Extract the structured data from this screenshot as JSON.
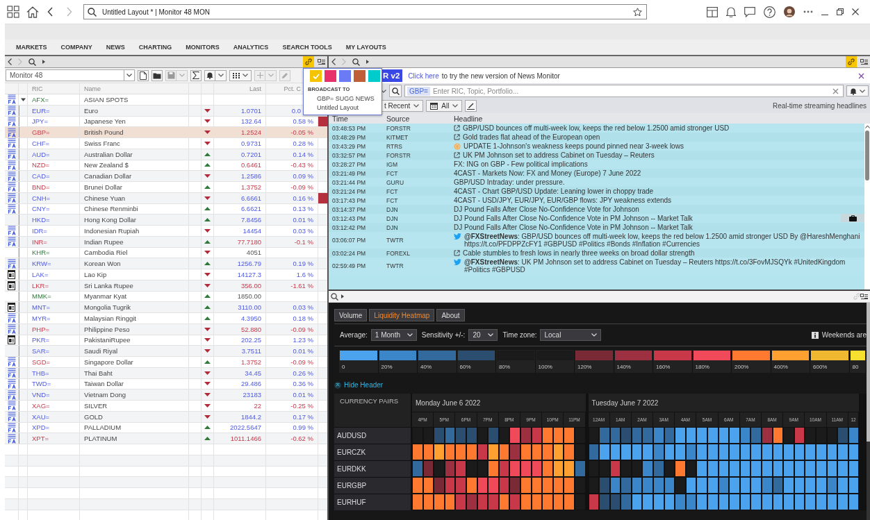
{
  "top_bar": {
    "address": "Untitled Layout * | Monitor 48 MON"
  },
  "menu": [
    "MARKETS",
    "COMPANY",
    "NEWS",
    "CHARTING",
    "MONITORS",
    "ANALYTICS",
    "SEARCH TOOLS",
    "MY LAYOUTS"
  ],
  "monitor": {
    "link_active": true,
    "name": "Monitor 48",
    "columns": [
      "RIC",
      "Name",
      "Last",
      "Pct. C"
    ],
    "rows": [
      {
        "kind": "group",
        "ric": "AFX=",
        "name": "ASIAN SPOTS",
        "expanded": true
      },
      {
        "kind": "chart",
        "ric": "EUR=",
        "name": "Euro",
        "rising": false,
        "last": "1.0701",
        "pct": "0.0",
        "negative": false,
        "no_change": false,
        "selected": false,
        "alert": false
      },
      {
        "kind": "chart",
        "ric": "JPY=",
        "name": "Japanese Yen",
        "rising": false,
        "last": "132.64",
        "pct": "0.58 %",
        "negative": false,
        "no_change": false,
        "selected": false,
        "alert": true
      },
      {
        "kind": "chart",
        "ric": "GBP=",
        "name": "British Pound",
        "rising": false,
        "last": "1.2524",
        "pct": "-0.05 %",
        "negative": true,
        "no_change": false,
        "selected": true,
        "alert": false
      },
      {
        "kind": "chart",
        "ric": "CHF=",
        "name": "Swiss Franc",
        "rising": false,
        "last": "0.9731",
        "pct": "0.28 %",
        "negative": false,
        "no_change": false,
        "selected": false,
        "alert": false
      },
      {
        "kind": "chart",
        "ric": "AUD=",
        "name": "Australian Dollar",
        "rising": true,
        "last": "0.7201",
        "pct": "0.14 %",
        "negative": false,
        "no_change": false,
        "selected": false,
        "alert": false
      },
      {
        "kind": "chart",
        "ric": "NZD=",
        "name": "New Zealand $",
        "rising": true,
        "last": "0.6461",
        "pct": "-0.43 %",
        "negative": true,
        "no_change": false,
        "selected": false,
        "alert": false
      },
      {
        "kind": "chart",
        "ric": "CAD=",
        "name": "Canadian Dollar",
        "rising": false,
        "last": "1.2586",
        "pct": "0.09 %",
        "negative": false,
        "no_change": false,
        "selected": false,
        "alert": false
      },
      {
        "kind": "chart",
        "ric": "BND=",
        "name": "Brunei Dollar",
        "rising": true,
        "last": "1.3752",
        "pct": "-0.09 %",
        "negative": true,
        "no_change": false,
        "selected": false,
        "alert": false
      },
      {
        "kind": "chart",
        "ric": "CNH=",
        "name": "Chinese Yuan",
        "rising": false,
        "last": "6.6661",
        "pct": "0.16 %",
        "negative": false,
        "no_change": false,
        "selected": false,
        "alert": true
      },
      {
        "kind": "chart",
        "ric": "CNY=",
        "name": "Chinese Renminbi",
        "rising": true,
        "last": "6.6621",
        "pct": "0.13 %",
        "negative": false,
        "no_change": false,
        "selected": false,
        "alert": false
      },
      {
        "kind": "plain",
        "ric": "HKD=",
        "name": "Hong Kong Dollar",
        "rising": true,
        "last": "7.8456",
        "pct": "0.01 %",
        "negative": false,
        "no_change": false,
        "selected": false,
        "alert": false
      },
      {
        "kind": "chart",
        "ric": "IDR=",
        "name": "Indonesian Rupiah",
        "rising": false,
        "last": "14454",
        "pct": "0.03 %",
        "negative": false,
        "no_change": false,
        "selected": false,
        "alert": false
      },
      {
        "kind": "chart",
        "ric": "INR=",
        "name": "Indian Rupee",
        "rising": true,
        "last": "77.7180",
        "pct": "-0.1 %",
        "negative": true,
        "no_change": false,
        "selected": false,
        "alert": false
      },
      {
        "kind": "plain",
        "ric": "KHR=",
        "name": "Cambodia Riel",
        "rising": false,
        "last": "4051",
        "no_change": true,
        "selected": false,
        "alert": false
      },
      {
        "kind": "chart",
        "ric": "KRW=",
        "name": "Korean Won",
        "rising": true,
        "last": "1256.79",
        "pct": "0.19 %",
        "negative": false,
        "no_change": false,
        "selected": false,
        "alert": false
      },
      {
        "kind": "doc",
        "ric": "LAK=",
        "name": "Lao Kip",
        "rising": false,
        "last": "14127.3",
        "pct": "1.6 %",
        "negative": false,
        "no_change": false,
        "selected": false,
        "alert": false
      },
      {
        "kind": "doc",
        "ric": "LKR=",
        "name": "Sri Lanka Rupee",
        "rising": false,
        "last": "356.00",
        "pct": "-1.61 %",
        "negative": true,
        "no_change": false,
        "selected": false,
        "alert": false
      },
      {
        "kind": "plain",
        "ric": "MMK=",
        "name": "Myanmar Kyat",
        "rising": true,
        "last": "1850.00",
        "no_change": true,
        "selected": false,
        "alert": false
      },
      {
        "kind": "doc",
        "ric": "MNT=",
        "name": "Mongolia Tugrik",
        "rising": true,
        "last": "3110.00",
        "pct": "0.03 %",
        "negative": false,
        "no_change": false,
        "selected": false,
        "alert": false
      },
      {
        "kind": "chart",
        "ric": "MYR=",
        "name": "Malaysian Ringgit",
        "rising": true,
        "last": "4.3950",
        "pct": "0.18 %",
        "negative": false,
        "no_change": false,
        "selected": false,
        "alert": false
      },
      {
        "kind": "chart",
        "ric": "PHP=",
        "name": "Philippine Peso",
        "rising": false,
        "last": "52.880",
        "pct": "-0.09 %",
        "negative": true,
        "no_change": false,
        "selected": false,
        "alert": false
      },
      {
        "kind": "doc",
        "ric": "PKR=",
        "name": "PakistaniRupee",
        "rising": false,
        "last": "202.25",
        "pct": "1.23 %",
        "negative": false,
        "no_change": false,
        "selected": false,
        "alert": false
      },
      {
        "kind": "plain",
        "ric": "SAR=",
        "name": "Saudi Riyal",
        "rising": false,
        "last": "3.7511",
        "pct": "0.01 %",
        "negative": false,
        "no_change": false,
        "selected": false,
        "alert": false
      },
      {
        "kind": "chart",
        "ric": "SGD=",
        "name": "Singapore Dollar",
        "rising": true,
        "last": "1.3752",
        "pct": "-0.09 %",
        "negative": true,
        "no_change": false,
        "selected": false,
        "alert": false
      },
      {
        "kind": "chart",
        "ric": "THB=",
        "name": "Thai Baht",
        "rising": false,
        "last": "34.45",
        "pct": "0.26 %",
        "negative": false,
        "no_change": false,
        "selected": false,
        "alert": false
      },
      {
        "kind": "chart",
        "ric": "TWD=",
        "name": "Taiwan Dollar",
        "rising": false,
        "last": "29.486",
        "pct": "0.36 %",
        "negative": false,
        "no_change": false,
        "selected": false,
        "alert": false
      },
      {
        "kind": "chart",
        "ric": "VND=",
        "name": "Vietnam Dong",
        "rising": false,
        "last": "23183",
        "pct": "0.01 %",
        "negative": false,
        "no_change": false,
        "selected": false,
        "alert": false
      },
      {
        "kind": "chart",
        "ric": "XAG=",
        "name": "SILVER",
        "rising": false,
        "last": "22",
        "pct": "-0.25 %",
        "negative": true,
        "no_change": false,
        "selected": false,
        "alert": false
      },
      {
        "kind": "chart",
        "ric": "XAU=",
        "name": "GOLD",
        "rising": false,
        "last": "1844.2",
        "pct": "0.17 %",
        "negative": false,
        "no_change": false,
        "selected": false,
        "alert": false
      },
      {
        "kind": "chart",
        "ric": "XPD=",
        "name": "PALLADIUM",
        "rising": true,
        "last": "2022.5647",
        "pct": "0.99 %",
        "negative": false,
        "no_change": false,
        "selected": false,
        "alert": false
      },
      {
        "kind": "chart",
        "ric": "XPT=",
        "name": "PLATINUM",
        "rising": true,
        "last": "1011.1466",
        "pct": "-0.62 %",
        "negative": true,
        "no_change": false,
        "selected": false,
        "alert": false
      }
    ]
  },
  "broadcast_popup": {
    "swatches": [
      {
        "color": "#f5c400",
        "selected": true
      },
      {
        "color": "#e8316b",
        "selected": false
      },
      {
        "color": "#6a7bf5",
        "selected": false
      },
      {
        "color": "#c06038",
        "selected": false
      },
      {
        "color": "#00cccc",
        "selected": false
      }
    ],
    "heading": "BROADCAST TO",
    "targets": [
      "GBP= SUGG NEWS",
      "Untitled Layout"
    ]
  },
  "news": {
    "link_active": true,
    "banner": {
      "badge": "R v2",
      "link": "Click here",
      "text": "to try the new version of News Monitor"
    },
    "search": {
      "token": "GBP=",
      "placeholder": "Enter RIC, Topic, Portfolio..."
    },
    "filters": {
      "sort": "t Recent",
      "date": "All"
    },
    "caption": "Real-time streaming headlines",
    "columns": [
      "Time",
      "Source",
      "Headline"
    ],
    "rows": [
      {
        "time": "03:48:53 PM",
        "source": "FORSTR",
        "kind": "link",
        "headline": "GBP/USD bounces off multi-week low, keeps the red below 1.2500 amid stronger USD",
        "tagged": false
      },
      {
        "time": "03:48:29 PM",
        "source": "KITMET",
        "kind": "link",
        "headline": "Gold trades flat ahead of the European open",
        "tagged": false
      },
      {
        "time": "03:43:29 PM",
        "source": "RTRS",
        "kind": "wire",
        "headline": "UPDATE 1-Johnson's weakness keeps pound pinned near 3-week lows",
        "tagged": false
      },
      {
        "time": "03:32:57 PM",
        "source": "FORSTR",
        "kind": "link",
        "headline": "UK PM Johnson set to address Cabinet on Tuesday – Reuters",
        "tagged": false
      },
      {
        "time": "03:28:27 PM",
        "source": "IGM",
        "kind": "plain",
        "headline": "FX: ING on GBP - Few political implications",
        "tagged": false
      },
      {
        "time": "03:21:49 PM",
        "source": "FCT",
        "kind": "plain",
        "headline": "4CAST - Markets Now: FX and Money (Europe) 7 June 2022",
        "tagged": false
      },
      {
        "time": "03:21:44 PM",
        "source": "GURU",
        "kind": "plain",
        "headline": "GBP/USD Intraday: under pressure.",
        "tagged": false
      },
      {
        "time": "03:21:24 PM",
        "source": "FCT",
        "kind": "plain",
        "headline": "4CAST - Chart GBP/USD Update: Leaning lower in choppy trade",
        "tagged": false
      },
      {
        "time": "03:17:43 PM",
        "source": "FCT",
        "kind": "plain",
        "headline": "4CAST - USD/JPY, EUR/JPY, EUR/GBP flows: JPY weakness extends",
        "tagged": false
      },
      {
        "time": "03:14:37 PM",
        "source": "DJN",
        "kind": "plain",
        "headline": "DJ Pound Falls After Close No-Confidence Vote for Johnson",
        "tagged": false
      },
      {
        "time": "03:12:43 PM",
        "source": "DJN",
        "kind": "plain",
        "headline": "DJ Pound Falls After Close No-Confidence Vote in PM Johnson -- Market Talk",
        "tagged": true
      },
      {
        "time": "03:12:42 PM",
        "source": "DJN",
        "kind": "plain",
        "headline": "DJ Pound Falls After Close No-Confidence Vote in PM Johnson -- Market Talk",
        "tagged": false
      },
      {
        "time": "03:06:07 PM",
        "source": "TWTR",
        "kind": "tweet",
        "headline": "**@FXStreetNews**: GBP/USD bounces off multi-week low, keeps the red below 1.2500 amid stronger USD By @HareshMenghani https://t.co/PFDPPZcFY1 #GBPUSD #Politics #Bonds #Inflation #Currencies",
        "tagged": false
      },
      {
        "time": "03:02:24 PM",
        "source": "FOREXL",
        "kind": "link",
        "headline": "Cable stumbles to fresh lows in nearly three weeks on broad dollar strength",
        "tagged": false
      },
      {
        "time": "02:59:49 PM",
        "source": "TWTR",
        "kind": "tweet",
        "headline": "**@FXStreetNews**: UK PM Johnson set to address Cabinet on Tuesday – Reuters https://t.co/3FovMJSQYk #UnitedKingdom #Politics #GBPUSD",
        "tagged": false
      }
    ]
  },
  "heatmap": {
    "tabs": [
      {
        "label": "Volume",
        "selected": false
      },
      {
        "label": "Liquidity Heatmap",
        "selected": true
      },
      {
        "label": "About",
        "selected": false
      }
    ],
    "controls": [
      {
        "label": "Average:",
        "value": "1 Month"
      },
      {
        "label": "Sensitivity +/-:",
        "value": "20"
      },
      {
        "label": "Time zone:",
        "value": "Local"
      }
    ],
    "note": "Weekends are",
    "legend": [
      {
        "label": "0",
        "color": "#4aa3ec"
      },
      {
        "label": "20%",
        "color": "#3a86c8"
      },
      {
        "label": "40%",
        "color": "#336a9e"
      },
      {
        "label": "60%",
        "color": "#2b4e70"
      },
      {
        "label": "80%",
        "color": "#1b1b1b"
      },
      {
        "label": "100%",
        "color": "#1b1b1b"
      },
      {
        "label": "120%",
        "color": "#7a2a35"
      },
      {
        "label": "140%",
        "color": "#9c3040"
      },
      {
        "label": "160%",
        "color": "#c83848"
      },
      {
        "label": "180%",
        "color": "#f04a5a"
      },
      {
        "label": "200%",
        "color": "#ff7a30"
      },
      {
        "label": "400%",
        "color": "#ffa030"
      },
      {
        "label": "600%",
        "color": "#f0b830"
      },
      {
        "label": "80",
        "color": "#f8e030"
      }
    ],
    "hide_header": "Hide Header",
    "pairs_heading": "CURRENCY PAIRS",
    "days": [
      {
        "label": "Monday June 6 2022",
        "hours": [
          "4PM",
          "5PM",
          "6PM",
          "7PM",
          "8PM",
          "9PM",
          "10PM",
          "11PM"
        ]
      },
      {
        "label": "Tuesday June 7 2022",
        "hours": [
          "12AM",
          "1AM",
          "2AM",
          "3AM",
          "4AM",
          "5AM",
          "6AM",
          "7AM",
          "8AM",
          "9AM",
          "10AM",
          "11AM",
          "12"
        ]
      }
    ],
    "rows": [
      {
        "pair": "AUDUSD",
        "cells": [
          [
            {
              "color": "#1b1b1b"
            },
            {
              "color": "#1b1b1b"
            },
            {
              "color": "#2b4e70"
            },
            {
              "color": "#336a9e"
            },
            {
              "color": "#2b4e70"
            },
            {
              "color": "#2b4e70"
            },
            {
              "color": "#1b1b1b"
            },
            {
              "color": "#2b4e70"
            },
            {
              "color": "#1b1b1b"
            },
            {
              "color": "#f04a5a"
            },
            {
              "color": "#9c3040"
            },
            {
              "color": "#c83848"
            },
            {
              "color": "#ff7a30"
            },
            {
              "color": "#ff7a30"
            },
            {
              "color": "#ff7a30"
            },
            {
              "color": "#1b1b1b"
            }
          ],
          [
            {
              "color": "#1b1b1b"
            },
            {
              "color": "#336a9e"
            },
            {
              "color": "#336a9e"
            },
            {
              "color": "#2b4e70"
            },
            {
              "color": "#336a9e"
            },
            {
              "color": "#336a9e"
            },
            {
              "color": "#3a86c8"
            },
            {
              "color": "#336a9e"
            },
            {
              "color": "#4aa3ec"
            },
            {
              "color": "#4aa3ec"
            },
            {
              "color": "#4aa3ec"
            },
            {
              "color": "#4aa3ec"
            },
            {
              "color": "#4aa3ec"
            },
            {
              "color": "#4aa3ec"
            },
            {
              "color": "#3a86c8"
            },
            {
              "color": "#336a9e"
            },
            {
              "color": "#9c3040"
            },
            {
              "color": "#ff7a30"
            },
            {
              "color": "#1b1b1b"
            },
            {
              "color": "#c83848"
            },
            {
              "color": "#1b1b1b"
            },
            {
              "color": "#1b1b1b"
            },
            {
              "color": "#1b1b1b"
            },
            {
              "color": "#2b4e70"
            },
            {
              "color": "#3a86c8"
            }
          ]
        ]
      },
      {
        "pair": "EURCZK",
        "cells": [
          [
            {
              "color": "#ff7a30"
            },
            {
              "color": "#ff7a30"
            },
            {
              "color": "#ffa030"
            },
            {
              "color": "#ff7a30"
            },
            {
              "color": "#ff7a30"
            },
            {
              "color": "#ff7a30"
            },
            {
              "color": "#c83848"
            },
            {
              "color": "#ffa030"
            },
            {
              "color": "#ff7a30"
            },
            {
              "color": "#9c3040"
            },
            {
              "color": "#ff7a30"
            },
            {
              "color": "#ff7a30"
            },
            {
              "color": "#ff7a30"
            },
            {
              "color": "#ffa030"
            },
            {
              "color": "#ff7a30"
            },
            {
              "color": "#1b1b1b"
            }
          ],
          [
            {
              "color": "#336a9e"
            },
            {
              "color": "#4aa3ec"
            },
            {
              "color": "#4aa3ec"
            },
            {
              "color": "#4aa3ec"
            },
            {
              "color": "#4aa3ec"
            },
            {
              "color": "#4aa3ec"
            },
            {
              "color": "#3a86c8"
            },
            {
              "color": "#4aa3ec"
            },
            {
              "color": "#4aa3ec"
            },
            {
              "color": "#3a86c8"
            },
            {
              "color": "#4aa3ec"
            },
            {
              "color": "#4aa3ec"
            },
            {
              "color": "#4aa3ec"
            },
            {
              "color": "#4aa3ec"
            },
            {
              "color": "#4aa3ec"
            },
            {
              "color": "#4aa3ec"
            },
            {
              "color": "#4aa3ec"
            },
            {
              "color": "#4aa3ec"
            },
            {
              "color": "#4aa3ec"
            },
            {
              "color": "#4aa3ec"
            },
            {
              "color": "#4aa3ec"
            },
            {
              "color": "#4aa3ec"
            },
            {
              "color": "#4aa3ec"
            },
            {
              "color": "#4aa3ec"
            },
            {
              "color": "#4aa3ec"
            }
          ]
        ]
      },
      {
        "pair": "EURDKK",
        "cells": [
          [
            {
              "color": "#336a9e"
            },
            {
              "color": "#7a2a35"
            },
            {
              "color": "#1b1b1b"
            },
            {
              "color": "#9c3040"
            },
            {
              "color": "#c83848"
            },
            {
              "color": "#1b1b1b"
            },
            {
              "color": "#1b1b1b"
            },
            {
              "color": "#ff7a30"
            },
            {
              "color": "#c83848"
            },
            {
              "color": "#f04a5a"
            },
            {
              "color": "#f04a5a"
            },
            {
              "color": "#f04a5a"
            },
            {
              "color": "#ff7a30"
            },
            {
              "color": "#ffa030"
            },
            {
              "color": "#ffa030"
            },
            {
              "color": "#336a9e"
            }
          ],
          [
            {
              "color": "#1b1b1b"
            },
            {
              "color": "#1b1b1b"
            },
            {
              "color": "#c83848"
            },
            {
              "color": "#1b1b1b"
            },
            {
              "color": "#1b1b1b"
            },
            {
              "color": "#3a86c8"
            },
            {
              "color": "#336a9e"
            },
            {
              "color": "#1b1b1b"
            },
            {
              "color": "#ff7a30"
            },
            {
              "color": "#1b1b1b"
            },
            {
              "color": "#4aa3ec"
            },
            {
              "color": "#4aa3ec"
            },
            {
              "color": "#4aa3ec"
            },
            {
              "color": "#4aa3ec"
            },
            {
              "color": "#4aa3ec"
            },
            {
              "color": "#4aa3ec"
            },
            {
              "color": "#4aa3ec"
            },
            {
              "color": "#4aa3ec"
            },
            {
              "color": "#4aa3ec"
            },
            {
              "color": "#4aa3ec"
            },
            {
              "color": "#4aa3ec"
            },
            {
              "color": "#4aa3ec"
            },
            {
              "color": "#4aa3ec"
            },
            {
              "color": "#4aa3ec"
            },
            {
              "color": "#4aa3ec"
            }
          ]
        ]
      },
      {
        "pair": "EURGBP",
        "cells": [
          [
            {
              "color": "#ff7a30"
            },
            {
              "color": "#ff7a30"
            },
            {
              "color": "#7a2a35"
            },
            {
              "color": "#c83848"
            },
            {
              "color": "#c83848"
            },
            {
              "color": "#ff7a30"
            },
            {
              "color": "#f04a5a"
            },
            {
              "color": "#f04a5a"
            },
            {
              "color": "#c83848"
            },
            {
              "color": "#7a2a35"
            },
            {
              "color": "#ff7a30"
            },
            {
              "color": "#ff7a30"
            },
            {
              "color": "#ff7a30"
            },
            {
              "color": "#ff7a30"
            },
            {
              "color": "#ff7a30"
            },
            {
              "color": "#1b1b1b"
            }
          ],
          [
            {
              "color": "#1b1b1b"
            },
            {
              "color": "#2b4e70"
            },
            {
              "color": "#3a86c8"
            },
            {
              "color": "#336a9e"
            },
            {
              "color": "#3a86c8"
            },
            {
              "color": "#3a86c8"
            },
            {
              "color": "#3a86c8"
            },
            {
              "color": "#3a86c8"
            },
            {
              "color": "#1b1b1b"
            },
            {
              "color": "#4aa3ec"
            },
            {
              "color": "#4aa3ec"
            },
            {
              "color": "#4aa3ec"
            },
            {
              "color": "#3a86c8"
            },
            {
              "color": "#4aa3ec"
            },
            {
              "color": "#4aa3ec"
            },
            {
              "color": "#4aa3ec"
            },
            {
              "color": "#3a86c8"
            },
            {
              "color": "#336a9e"
            },
            {
              "color": "#4aa3ec"
            },
            {
              "color": "#4aa3ec"
            },
            {
              "color": "#4aa3ec"
            },
            {
              "color": "#4aa3ec"
            },
            {
              "color": "#3a86c8"
            },
            {
              "color": "#4aa3ec"
            },
            {
              "color": "#4aa3ec"
            }
          ]
        ]
      },
      {
        "pair": "EURHUF",
        "cells": [
          [
            {
              "color": "#ff7a30"
            },
            {
              "color": "#ff7a30"
            },
            {
              "color": "#ff7a30"
            },
            {
              "color": "#ff7a30"
            },
            {
              "color": "#c83848"
            },
            {
              "color": "#9c3040"
            },
            {
              "color": "#c83848"
            },
            {
              "color": "#c83848"
            },
            {
              "color": "#ff7a30"
            },
            {
              "color": "#c83848"
            },
            {
              "color": "#ff7a30"
            },
            {
              "color": "#ff7a30"
            },
            {
              "color": "#ff7a30"
            },
            {
              "color": "#ff7a30"
            },
            {
              "color": "#ff7a30"
            },
            {
              "color": "#1b1b1b"
            }
          ],
          [
            {
              "color": "#c83848"
            },
            {
              "color": "#2b4e70"
            },
            {
              "color": "#2b4e70"
            },
            {
              "color": "#336a9e"
            },
            {
              "color": "#4aa3ec"
            },
            {
              "color": "#4aa3ec"
            },
            {
              "color": "#4aa3ec"
            },
            {
              "color": "#4aa3ec"
            },
            {
              "color": "#3a86c8"
            },
            {
              "color": "#3a86c8"
            },
            {
              "color": "#4aa3ec"
            },
            {
              "color": "#4aa3ec"
            },
            {
              "color": "#4aa3ec"
            },
            {
              "color": "#4aa3ec"
            },
            {
              "color": "#4aa3ec"
            },
            {
              "color": "#4aa3ec"
            },
            {
              "color": "#4aa3ec"
            },
            {
              "color": "#4aa3ec"
            },
            {
              "color": "#4aa3ec"
            },
            {
              "color": "#4aa3ec"
            },
            {
              "color": "#4aa3ec"
            },
            {
              "color": "#4aa3ec"
            },
            {
              "color": "#4aa3ec"
            },
            {
              "color": "#4aa3ec"
            },
            {
              "color": "#4aa3ec"
            }
          ]
        ]
      }
    ]
  }
}
